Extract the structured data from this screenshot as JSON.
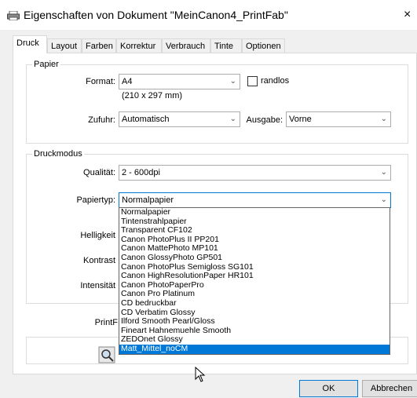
{
  "window": {
    "title": "Eigenschaften von Dokument \"MeinCanon4_PrintFab\"",
    "close": "×",
    "icon": "printer-icon"
  },
  "tabs": [
    "Druck",
    "Layout",
    "Farben",
    "Korrektur",
    "Verbrauch",
    "Tinte",
    "Optionen"
  ],
  "papier": {
    "group_label": "Papier",
    "format_label": "Format:",
    "format_value": "A4",
    "format_dims": "(210 x 297 mm)",
    "randlos_label": "randlos",
    "zufuhr_label": "Zufuhr:",
    "zufuhr_value": "Automatisch",
    "ausgabe_label": "Ausgabe:",
    "ausgabe_value": "Vorne"
  },
  "druckmodus": {
    "group_label": "Druckmodus",
    "qualitaet_label": "Qualität:",
    "qualitaet_value": "2 - 600dpi",
    "papiertyp_label": "Papiertyp:",
    "papiertyp_value": "Normalpapier",
    "helligkeit_label": "Helligkeit",
    "kontrast_label": "Kontrast",
    "intensitaet_label": "Intensität",
    "printf_label": "PrintF"
  },
  "papiertyp_options": [
    "Normalpapier",
    "Tintenstrahlpapier",
    "Transparent CF102",
    "Canon PhotoPlus II PP201",
    "Canon MattePhoto MP101",
    "Canon GlossyPhoto GP501",
    "Canon PhotoPlus Semigloss SG101",
    "Canon HighResolutionPaper HR101",
    "Canon PhotoPaperPro",
    "Canon Pro Platinum",
    "CD bedruckbar",
    "CD Verbatim Glossy",
    "Ilford Smooth Pearl/Gloss",
    "Fineart Hahnemuehle Smooth",
    "ZEDOnet Glossy",
    "Matt_Mittel_noCM"
  ],
  "papiertyp_selected_index": 15,
  "buttons": {
    "ok": "OK",
    "abbrechen": "Abbrechen"
  },
  "colors": {
    "accent": "#0078d7",
    "background": "#f0f0f0"
  }
}
